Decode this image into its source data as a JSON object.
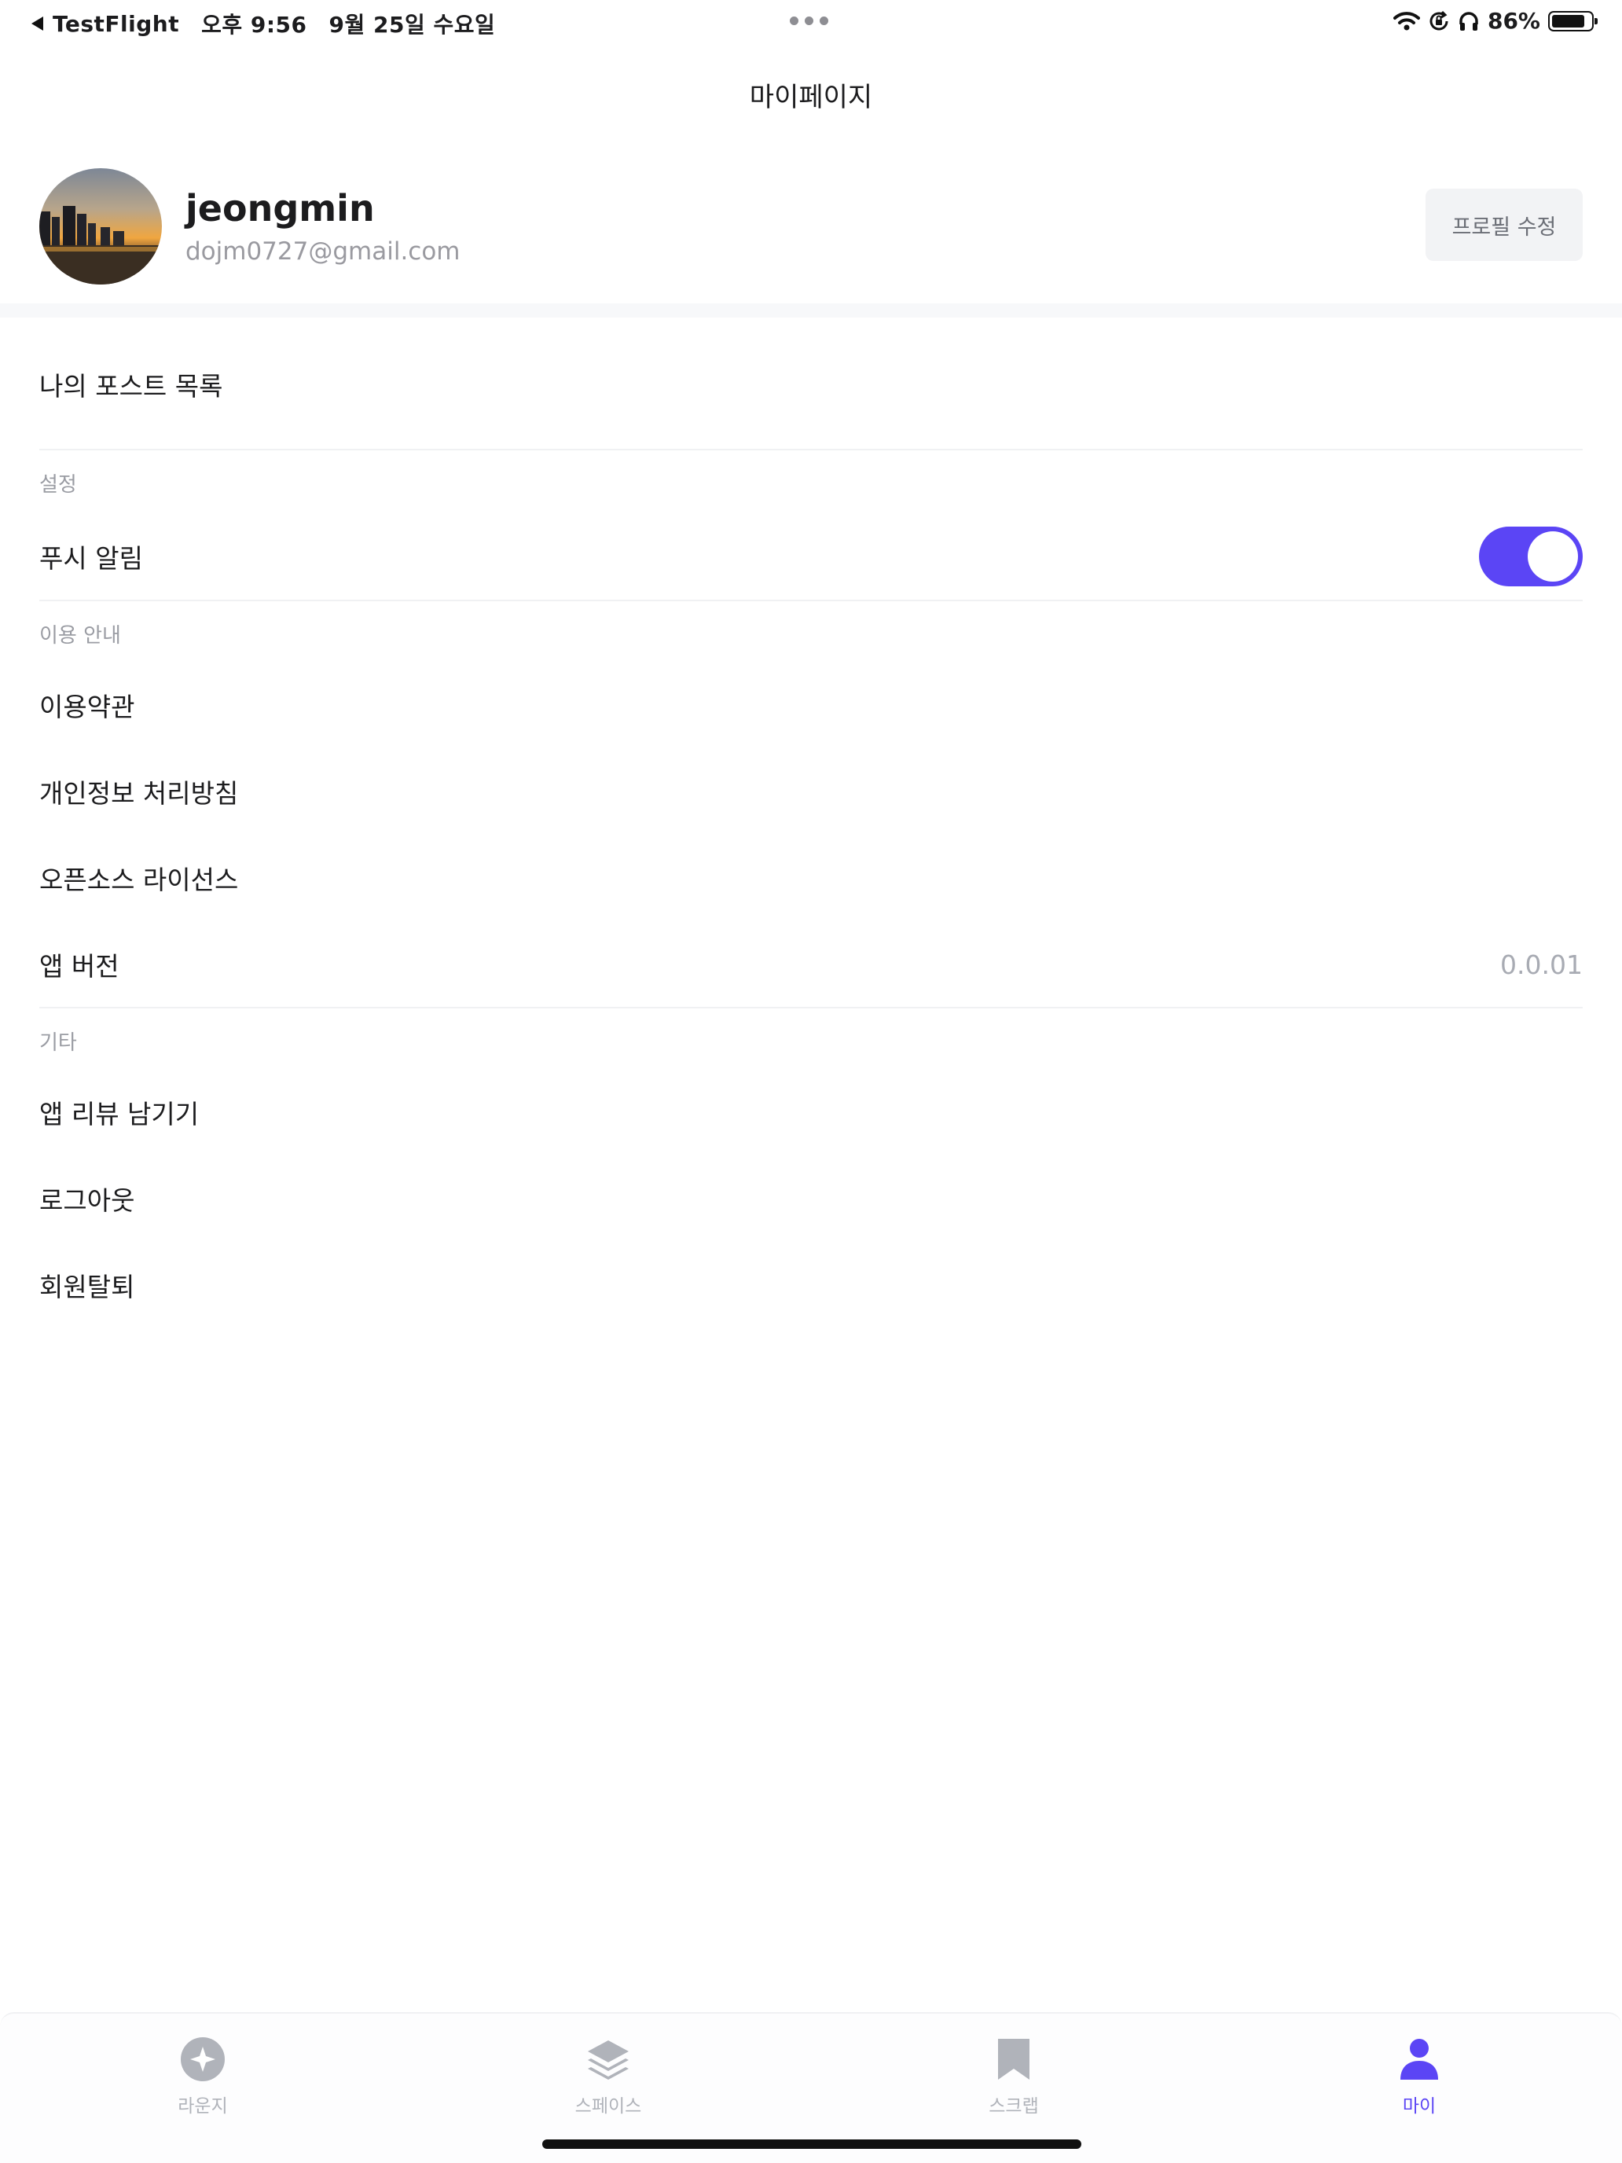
{
  "status_bar": {
    "back_app": "TestFlight",
    "time": "오후 9:56",
    "date": "9월 25일 수요일",
    "battery": "86%",
    "battery_level": 0.86
  },
  "header": {
    "title": "마이페이지"
  },
  "profile": {
    "name": "jeongmin",
    "email": "dojm0727@gmail.com",
    "edit_label": "프로필 수정"
  },
  "menu": {
    "my_posts": "나의 포스트 목록",
    "settings_section": "설정",
    "push_label": "푸시 알림",
    "push_enabled": true,
    "info_section": "이용 안내",
    "terms": "이용약관",
    "privacy": "개인정보 처리방침",
    "open_source": "오픈소스 라이선스",
    "version_label": "앱 버전",
    "version_value": "0.0.01",
    "etc_section": "기타",
    "review": "앱 리뷰 남기기",
    "logout": "로그아웃",
    "withdraw": "회원탈퇴"
  },
  "tabs": [
    {
      "label": "라운지",
      "icon": "lounge-icon",
      "active": false
    },
    {
      "label": "스페이스",
      "icon": "layers-icon",
      "active": false
    },
    {
      "label": "스크랩",
      "icon": "bookmark-icon",
      "active": false
    },
    {
      "label": "마이",
      "icon": "person-icon",
      "active": true
    }
  ],
  "colors": {
    "accent": "#5b45f5",
    "inactive_tab": "#b0b3ba",
    "section_label": "#9a9ca3"
  }
}
